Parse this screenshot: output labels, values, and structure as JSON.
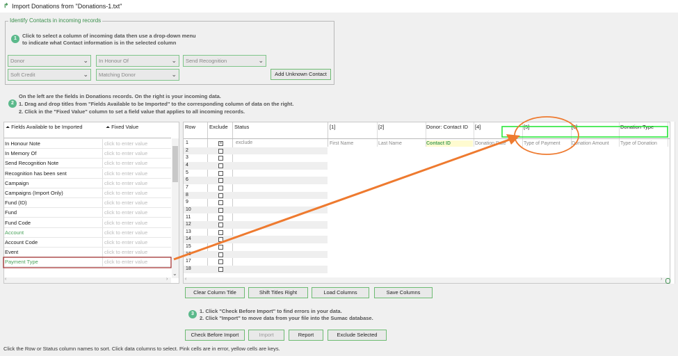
{
  "window": {
    "title": "Import Donations from \"Donations-1.txt\"",
    "icon": "import-arrow-icon"
  },
  "identify": {
    "legend": "Identify Contacts in incoming records",
    "step": "1",
    "line1": "Click to select a column of incoming data then use a drop-down menu",
    "line2": "to indicate what Contact information is in the selected column",
    "dropdowns": [
      {
        "value": "Donor"
      },
      {
        "value": "In Honour Of"
      },
      {
        "value": "Send Recognition"
      },
      {
        "value": "Soft Credit"
      },
      {
        "value": "Matching Donor"
      }
    ],
    "add_unknown": "Add Unknown Contact"
  },
  "step2": {
    "step": "2",
    "line1": "On the left are the fields in Donations records. On the right is your incoming data.",
    "line2": "1. Drag and drop titles from \"Fields Available to be Imported\" to the corresponding column of data on the right.",
    "line3": "2. Click in the \"Fixed Value\" column to set a field value that applies to all incoming records."
  },
  "fields_panel": {
    "col1": "Fields Available to be Imported",
    "col2": "Fixed Value",
    "placeholder": "click to enter value",
    "rows": [
      {
        "name": "In Honour Note"
      },
      {
        "name": "In Memory Of"
      },
      {
        "name": "Send Recognition Note"
      },
      {
        "name": "Recognition has been sent"
      },
      {
        "name": "Campaign"
      },
      {
        "name": "Campaigns (Import Only)"
      },
      {
        "name": "Fund (ID)"
      },
      {
        "name": "Fund"
      },
      {
        "name": "Fund Code"
      },
      {
        "name": "Account"
      },
      {
        "name": "Account Code"
      },
      {
        "name": "Event"
      },
      {
        "name": "Payment Type"
      }
    ]
  },
  "data_grid": {
    "headers": {
      "row": "Row",
      "exclude": "Exclude",
      "status": "Status"
    },
    "columns": [
      {
        "index": "[1]",
        "title": "",
        "sub": "First Name"
      },
      {
        "index": "[2]",
        "title": "",
        "sub": "Last Name"
      },
      {
        "index": "",
        "title": "Donor: Contact ID",
        "sub": "Contact ID"
      },
      {
        "index": "[4]",
        "title": "",
        "sub": "Donation Date"
      },
      {
        "index": "[5]",
        "title": "",
        "sub": "Type of Payment"
      },
      {
        "index": "[6]",
        "title": "",
        "sub": "Donation Amount"
      },
      {
        "index": "",
        "title": "Donation Type",
        "sub": "Type of Donation"
      }
    ],
    "status_first": "exclude",
    "rows": [
      "1",
      "2",
      "3",
      "4",
      "5",
      "6",
      "7",
      "8",
      "9",
      "10",
      "11",
      "12",
      "13",
      "14",
      "15",
      "16",
      "17",
      "18"
    ]
  },
  "grid_buttons": [
    "Clear Column Title",
    "Shift Titles Right",
    "Load Columns",
    "Save Columns"
  ],
  "step3": {
    "step": "3",
    "line1": "1. Click \"Check Before Import\" to find errors in your data.",
    "line2": "2. Click \"Import\" to move data from your file into the Sumac database."
  },
  "action_buttons": [
    "Check Before Import",
    "Import",
    "Report",
    "Exclude Selected"
  ],
  "status_bar": "Click the Row or Status column names to sort. Click data columns to select. Pink cells are in error, yellow cells are keys.",
  "colors": {
    "accent": "#4aa25b",
    "key_cell": "#fffbd0",
    "annotation": "#ee7a2f",
    "highlight": "#29e63a",
    "selected_field_border": "#a02828"
  }
}
